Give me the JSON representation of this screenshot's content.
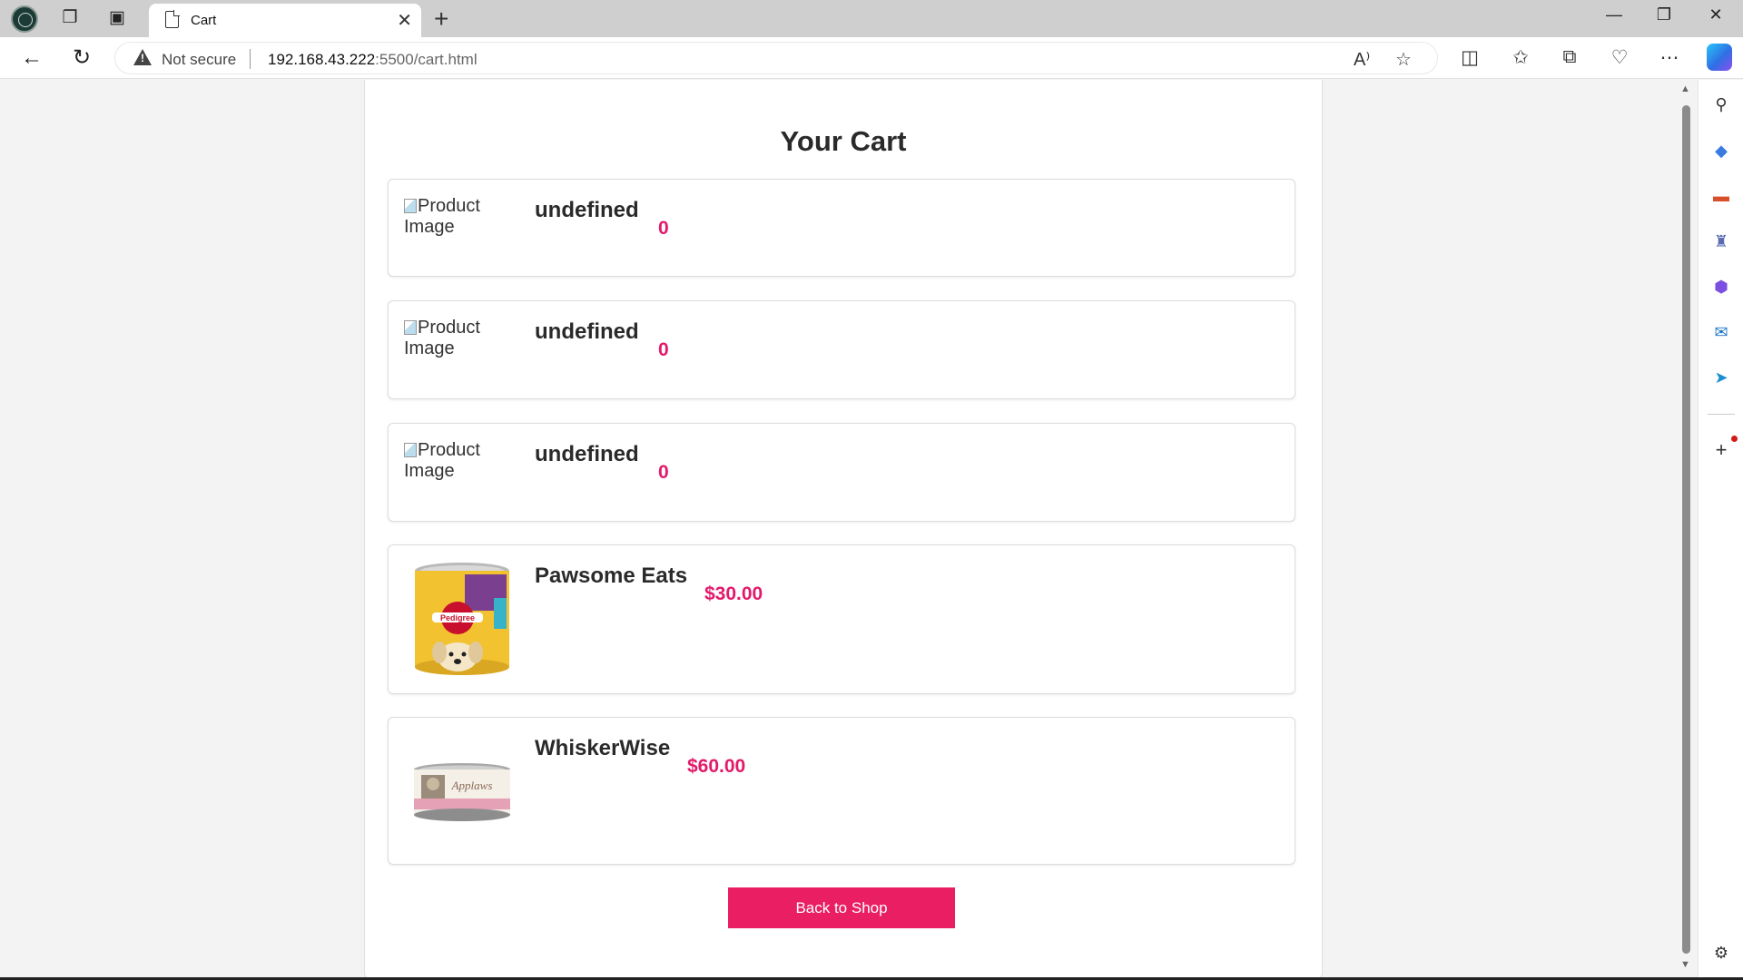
{
  "browser": {
    "tab_title": "Cart",
    "security_label": "Not secure",
    "url_host": "192.168.43.222",
    "url_path": ":5500/cart.html",
    "new_tab_symbol": "+",
    "close_tab_symbol": "✕"
  },
  "page": {
    "title": "Your Cart",
    "back_button_label": "Back to Shop"
  },
  "cart_items": [
    {
      "image_alt": "Product Image",
      "name": "undefined",
      "price": "0",
      "has_image": false
    },
    {
      "image_alt": "Product Image",
      "name": "undefined",
      "price": "0",
      "has_image": false
    },
    {
      "image_alt": "Product Image",
      "name": "undefined",
      "price": "0",
      "has_image": false
    },
    {
      "image_alt": "Pedigree",
      "name": "Pawsome Eats",
      "price": "$30.00",
      "has_image": true
    },
    {
      "image_alt": "Applaws",
      "name": "WhiskerWise",
      "price": "$60.00",
      "has_image": true
    }
  ],
  "colors": {
    "accent": "#e91e63",
    "price": "#e3196b",
    "title_text": "#2a2a2a"
  },
  "icons": [
    "workspaces-icon",
    "tab-actions-icon",
    "back-icon",
    "refresh-icon",
    "read-aloud-icon",
    "favorite-star-icon",
    "split-screen-icon",
    "favorites-icon",
    "collections-icon",
    "browser-essentials-icon",
    "more-icon",
    "copilot-icon",
    "search-icon",
    "shopping-icon",
    "tools-icon",
    "games-icon",
    "microsoft365-icon",
    "outlook-icon",
    "send-icon",
    "add-icon",
    "settings-icon"
  ]
}
